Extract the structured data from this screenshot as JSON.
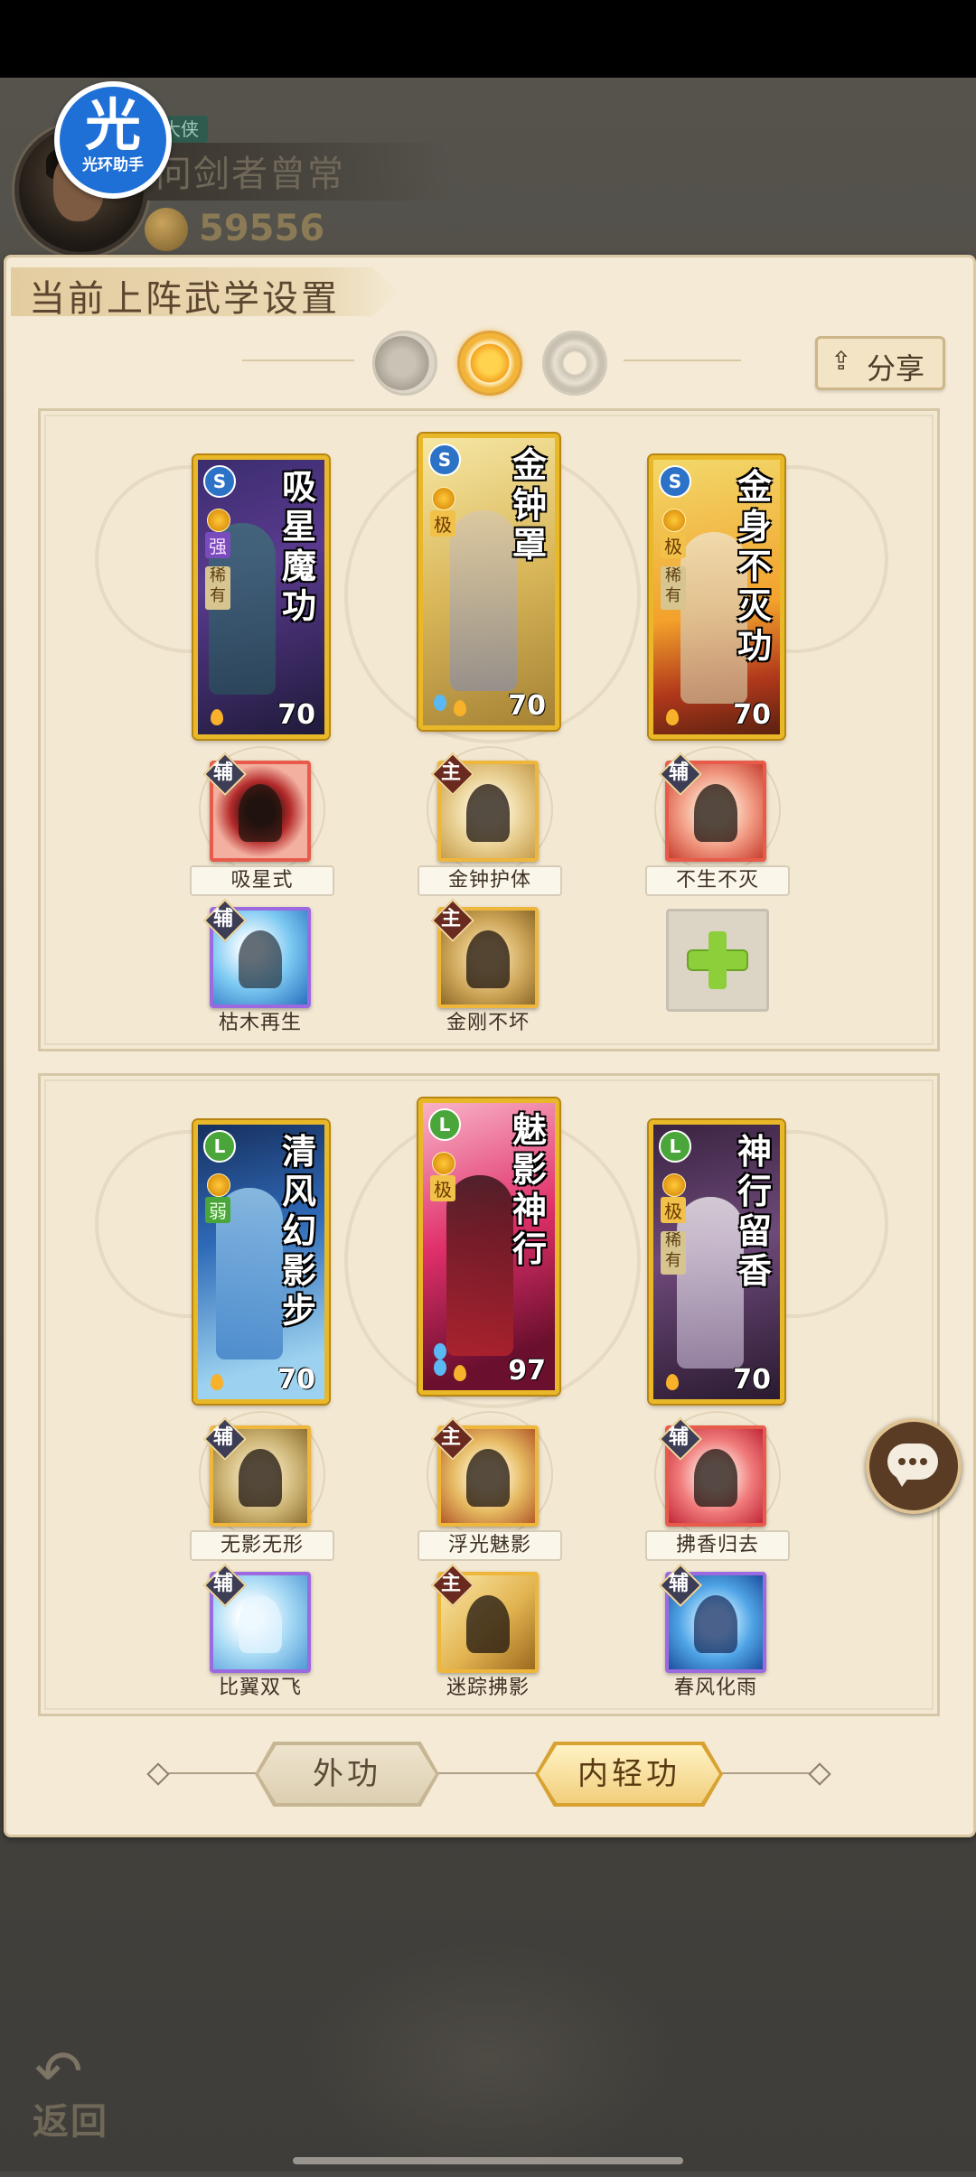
{
  "player": {
    "title_tag": "大侠",
    "name": "问剑者曾常",
    "power": "59556"
  },
  "badge": {
    "big": "光",
    "small": "光环助手"
  },
  "panel": {
    "heading": "当前上阵武学设置"
  },
  "share_label": "分享",
  "mode_icons": [
    "moon-icon",
    "sun-icon",
    "ring-icon"
  ],
  "section1": {
    "cards": [
      {
        "name": "吸星魔功",
        "type_icon": "S",
        "grade": "强",
        "rarity": "稀有",
        "level": "70"
      },
      {
        "name": "金钟罩",
        "type_icon": "S",
        "grade": "极",
        "rarity": "",
        "level": "70"
      },
      {
        "name": "金身不灭功",
        "type_icon": "S",
        "grade": "极",
        "rarity": "稀有",
        "level": "70"
      }
    ],
    "skills_row1": [
      {
        "tag": "辅",
        "label": "吸星式"
      },
      {
        "tag": "主",
        "label": "金钟护体"
      },
      {
        "tag": "辅",
        "label": "不生不灭"
      }
    ],
    "skills_row2": [
      {
        "tag": "辅",
        "label": "枯木再生"
      },
      {
        "tag": "主",
        "label": "金刚不坏"
      }
    ]
  },
  "section2": {
    "cards": [
      {
        "name": "清风幻影步",
        "type_icon": "L",
        "grade": "弱",
        "rarity": "",
        "level": "70"
      },
      {
        "name": "魅影神行",
        "type_icon": "L",
        "grade": "极",
        "rarity": "",
        "level": "97"
      },
      {
        "name": "神行留香",
        "type_icon": "L",
        "grade": "极",
        "rarity": "稀有",
        "level": "70"
      }
    ],
    "skills_row1": [
      {
        "tag": "辅",
        "label": "无影无形"
      },
      {
        "tag": "主",
        "label": "浮光魅影"
      },
      {
        "tag": "辅",
        "label": "拂香归去"
      }
    ],
    "skills_row2": [
      {
        "tag": "辅",
        "label": "比翼双飞"
      },
      {
        "tag": "主",
        "label": "迷踪拂影"
      },
      {
        "tag": "辅",
        "label": "春风化雨"
      }
    ]
  },
  "tabs": [
    {
      "label": "外功",
      "active": false
    },
    {
      "label": "内轻功",
      "active": true
    }
  ],
  "back_label": "返回",
  "colors": {
    "accent_gold": "#e9b828",
    "panel_bg": "#f4ead5",
    "add_green": "#8ccf3a"
  }
}
